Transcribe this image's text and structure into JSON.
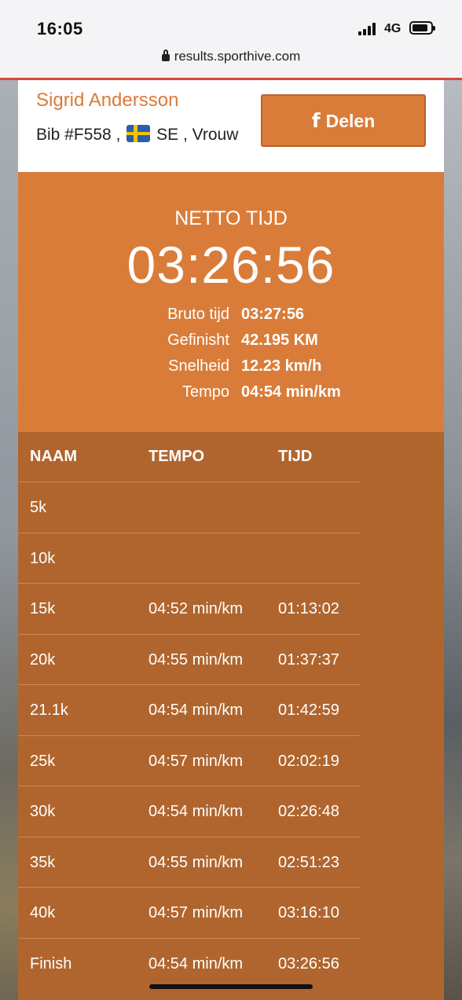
{
  "status": {
    "time": "16:05",
    "network": "4G"
  },
  "url": "results.sporthive.com",
  "runner": {
    "name": "Sigrid Andersson",
    "bib": "Bib #F558 ,",
    "country": "SE",
    "gender": ", Vrouw"
  },
  "share_label": "Delen",
  "summary": {
    "netto_label": "NETTO TIJD",
    "netto_time": "03:26:56",
    "stats": [
      {
        "label": "Bruto tijd",
        "value": "03:27:56"
      },
      {
        "label": "Gefinisht",
        "value": "42.195 KM"
      },
      {
        "label": "Snelheid",
        "value": "12.23 km/h"
      },
      {
        "label": "Tempo",
        "value": "04:54 min/km"
      }
    ]
  },
  "splits": {
    "headers": {
      "name": "NAAM",
      "tempo": "TEMPO",
      "tijd": "TIJD"
    },
    "rows": [
      {
        "name": "5k",
        "tempo": "",
        "tijd": ""
      },
      {
        "name": "10k",
        "tempo": "",
        "tijd": ""
      },
      {
        "name": "15k",
        "tempo": "04:52 min/km",
        "tijd": "01:13:02"
      },
      {
        "name": "20k",
        "tempo": "04:55 min/km",
        "tijd": "01:37:37"
      },
      {
        "name": "21.1k",
        "tempo": "04:54 min/km",
        "tijd": "01:42:59"
      },
      {
        "name": "25k",
        "tempo": "04:57 min/km",
        "tijd": "02:02:19"
      },
      {
        "name": "30k",
        "tempo": "04:54 min/km",
        "tijd": "02:26:48"
      },
      {
        "name": "35k",
        "tempo": "04:55 min/km",
        "tijd": "02:51:23"
      },
      {
        "name": "40k",
        "tempo": "04:57 min/km",
        "tijd": "03:16:10"
      },
      {
        "name": "Finish",
        "tempo": "04:54 min/km",
        "tijd": "03:26:56"
      }
    ]
  },
  "colors": {
    "accent": "#da7c39",
    "table_bg": "#b0652e",
    "header_bg": "#ffffff"
  }
}
